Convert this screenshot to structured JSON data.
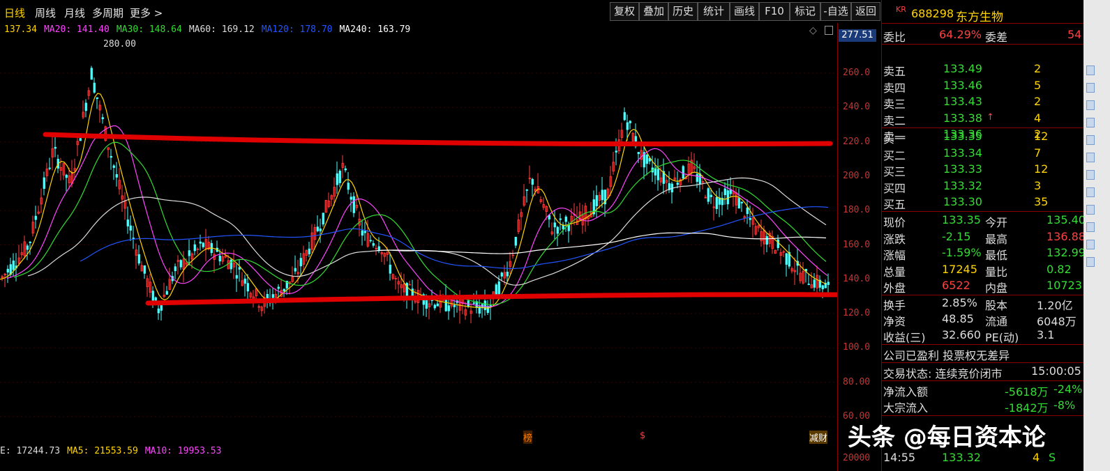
{
  "periods": {
    "day": "日线",
    "week": "周线",
    "month": "月线",
    "multi": "多周期",
    "more": "更多 >"
  },
  "toolbar": {
    "fuquan": "复权",
    "diejia": "叠加",
    "lishi": "历史",
    "tongji": "统计",
    "huaxian": "画线",
    "f10": "F10",
    "biaoji": "标记",
    "zixuan": "-自选",
    "fanhui": "返回"
  },
  "ma_legend": [
    {
      "label": "137.34",
      "color": "#ffd400"
    },
    {
      "label": "MA20: 141.40",
      "color": "#ff44ff"
    },
    {
      "label": "MA30: 148.64",
      "color": "#33dd33"
    },
    {
      "label": "MA60: 169.12",
      "color": "#dddddd"
    },
    {
      "label": "MA120: 178.70",
      "color": "#2255ff"
    },
    {
      "label": "MA240: 163.79",
      "color": "#ffffff"
    }
  ],
  "high_marker": "280.00",
  "axis_current": "277.51",
  "y_axis": [
    "260.0",
    "240.0",
    "220.0",
    "200.0",
    "180.0",
    "160.0",
    "140.0",
    "120.0",
    "100.0",
    "80.00",
    "60.00"
  ],
  "vol_axis": "20000",
  "vol_legend": [
    {
      "label": "E: 17244.73",
      "color": "#dddddd"
    },
    {
      "label": "MA5: 21553.59",
      "color": "#ffd400"
    },
    {
      "label": "MA10: 19953.53",
      "color": "#ff44ff"
    }
  ],
  "bottom_marks": {
    "bang": "榜",
    "s": "$",
    "jiancai": "减财"
  },
  "stock": {
    "badge": "KR",
    "code": "688298",
    "name": "东方生物"
  },
  "weibi": {
    "label": "委比",
    "value": "64.29%",
    "label2": "委差",
    "value2": "54"
  },
  "sells": [
    {
      "label": "卖五",
      "price": "133.49",
      "vol": "2"
    },
    {
      "label": "卖四",
      "price": "133.46",
      "vol": "5"
    },
    {
      "label": "卖三",
      "price": "133.43",
      "vol": "2"
    },
    {
      "label": "卖二",
      "price": "133.38",
      "vol": "4"
    },
    {
      "label": "卖一",
      "price": "133.36",
      "vol": "2"
    }
  ],
  "buys": [
    {
      "label": "买一",
      "price": "133.35",
      "vol": "12"
    },
    {
      "label": "买二",
      "price": "133.34",
      "vol": "7"
    },
    {
      "label": "买三",
      "price": "133.33",
      "vol": "12"
    },
    {
      "label": "买四",
      "price": "133.32",
      "vol": "3"
    },
    {
      "label": "买五",
      "price": "133.30",
      "vol": "35"
    }
  ],
  "quote": [
    {
      "l1": "现价",
      "v1": "133.35",
      "l2": "今开",
      "v2": "135.40",
      "c1": "#33dd33",
      "c2": "#33dd33"
    },
    {
      "l1": "涨跌",
      "v1": "-2.15",
      "l2": "最高",
      "v2": "136.88",
      "c1": "#33dd33",
      "c2": "#ff4040"
    },
    {
      "l1": "涨幅",
      "v1": "-1.59%",
      "l2": "最低",
      "v2": "132.99",
      "c1": "#33dd33",
      "c2": "#33dd33"
    },
    {
      "l1": "总量",
      "v1": "17245",
      "l2": "量比",
      "v2": "0.82",
      "c1": "#ffd400",
      "c2": "#33dd33"
    },
    {
      "l1": "外盘",
      "v1": "6522",
      "l2": "内盘",
      "v2": "10723",
      "c1": "#ff4040",
      "c2": "#33dd33"
    }
  ],
  "fund": [
    {
      "l1": "换手",
      "v1": "2.85%",
      "l2": "股本",
      "v2": "1.20亿"
    },
    {
      "l1": "净资",
      "v1": "48.85",
      "l2": "流通",
      "v2": "6048万"
    },
    {
      "l1": "收益(三)",
      "v1": "32.660",
      "l2": "PE(动)",
      "v2": "3.1"
    }
  ],
  "notice": "公司已盈利 投票权无差异",
  "trade_status": {
    "label": "交易状态: 连续竞价闭市",
    "time": "15:00:05"
  },
  "flow": [
    {
      "label": "净流入额",
      "value": "-5618万",
      "pct": "-24%"
    },
    {
      "label": "大宗流入",
      "value": "-1842万",
      "pct": "-8%"
    }
  ],
  "ticks": [
    {
      "time": "14:55",
      "price": "133.32",
      "vol": "4",
      "dir": "S"
    }
  ],
  "watermark": "头条 @每日资本论",
  "colors": {
    "up": "#ff4040",
    "down": "#33dd33",
    "trend": "#e00000"
  }
}
